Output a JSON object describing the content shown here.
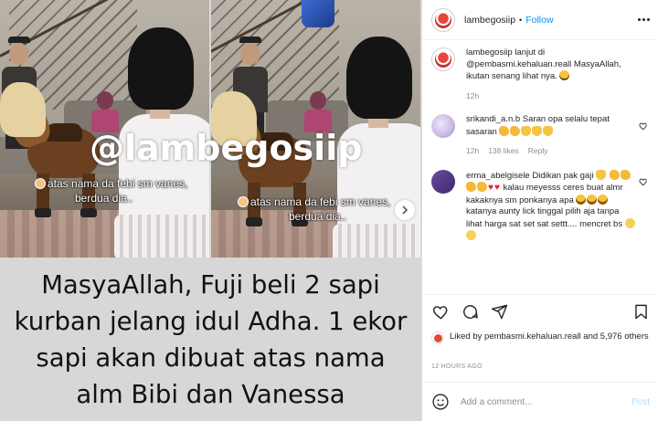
{
  "post": {
    "username": "lambegosiip",
    "separator": "•",
    "follow_label": "Follow",
    "media": {
      "watermark": "@lambegosiip",
      "overlay_caption_line1": "atas nama da febi sm vanes,",
      "overlay_caption_line2": "berdua dia..",
      "headline": "MasyaAllah, Fuji beli 2 sapi kurban jelang idul Adha. 1 ekor sapi akan dibuat atas nama alm Bibi dan Vanessa"
    },
    "caption": {
      "username": "lambegosiip",
      "text": "lanjut di @pembasmi.kehaluan.reall MasyaAllah, ikutan senang lihat nya.",
      "time": "12h"
    },
    "comments": [
      {
        "username": "srikandi_a.n.b",
        "text": "Saran opa selalu tepat sasaran",
        "time": "12h",
        "likes": "138 likes",
        "reply_label": "Reply"
      },
      {
        "username": "erma_abelgisele",
        "text_a": "Didikan pak gaji",
        "text_b": "kalau meyesss ceres buat almr kakaknya sm ponkanya apa",
        "text_c": "katanya aunty lick tinggal pilih aja tanpa lihat harga sat set sat settt.... mencret bs"
      }
    ],
    "likes_text_prefix": "Liked by",
    "likes_user": "pembasmi.kehaluan.reall",
    "likes_and": "and",
    "likes_others": "5,976 others",
    "timestamp": "12 HOURS AGO",
    "add_comment_placeholder": "Add a comment...",
    "post_label": "Post"
  },
  "colors": {
    "link": "#0095f6",
    "muted": "#8e8e8e",
    "post_disabled": "#b3dbff"
  },
  "icons": [
    "chevron-right-icon",
    "heart-icon",
    "comment-icon",
    "share-icon",
    "bookmark-icon",
    "emoji-icon",
    "more-icon"
  ]
}
